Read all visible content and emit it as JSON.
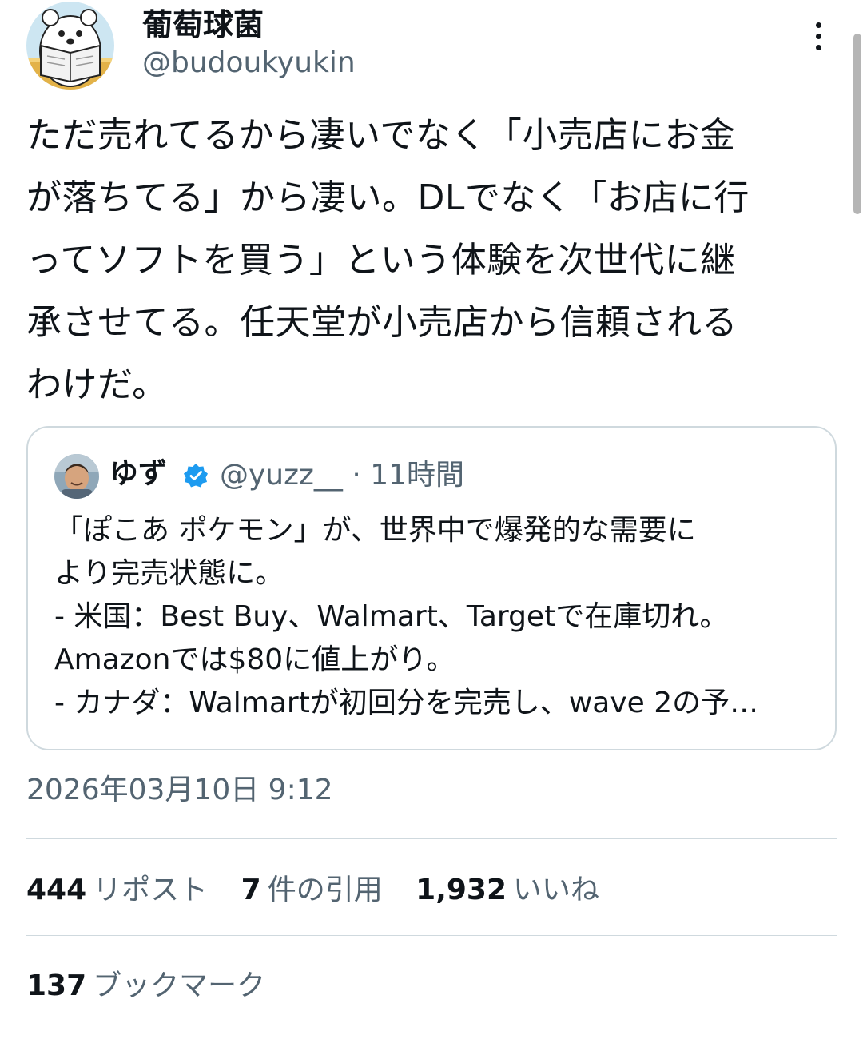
{
  "author": {
    "display_name": "葡萄球菌",
    "handle": "@budoukyukin"
  },
  "tweet": {
    "lines": [
      "ただ売れてるから凄いでなく「小売店にお金",
      "が落ちてる」から凄い。DLでなく「お店に行",
      "ってソフトを買う」という体験を次世代に継",
      "承させてる。任天堂が小売店から信頼される",
      "わけだ。"
    ],
    "timestamp": "2026年03月10日 9:12"
  },
  "quoted": {
    "display_name": "ゆず",
    "meta": "@yuzz__ · 11時間",
    "lines": [
      "「ぽこあ ポケモン」が、世界中で爆発的な需要に",
      "より完売状態に。",
      "- 米国：Best Buy、Walmart、Targetで在庫切れ。",
      "Amazonでは$80に値上がり。",
      "- カナダ：Walmartが初回分を完売し、wave 2の予…"
    ]
  },
  "stats": {
    "reposts_count": "444",
    "reposts_label": "リポスト",
    "quotes_count": "7",
    "quotes_label": "件の引用",
    "likes_count": "1,932",
    "likes_label": "いいね",
    "bookmarks_count": "137",
    "bookmarks_label": "ブックマーク"
  },
  "icons": {
    "more": "vertical-ellipsis-icon",
    "verified": "verified-badge-icon"
  },
  "colors": {
    "text": "#0f1419",
    "secondary": "#536471",
    "border": "#cfd9de",
    "verified": "#1d9bf0"
  }
}
